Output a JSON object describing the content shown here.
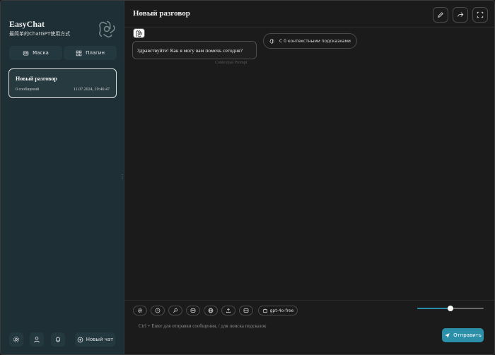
{
  "sidebar": {
    "brand_title": "EasyChat",
    "brand_subtitle": "最简单的ChatGPT使用方式",
    "logo_icon": "openai-logo-icon",
    "mask_button": {
      "label": "Маска",
      "icon": "mask-icon"
    },
    "plugin_button": {
      "label": "Плагин",
      "icon": "grid-plugin-icon"
    },
    "chats": [
      {
        "title": "Новый разговор",
        "count": "0 сообщений",
        "date": "11.07.2024, 19:46:47",
        "selected": true
      }
    ],
    "bottom_tools": [
      {
        "icon": "settings-icon"
      },
      {
        "icon": "user-icon"
      },
      {
        "icon": "bell-icon"
      }
    ],
    "new_chat_label": "Новый чат",
    "new_chat_icon": "plus-circle-icon"
  },
  "header": {
    "title": "Новый разговор",
    "actions": [
      "edit-icon",
      "share-icon",
      "fullscreen-icon"
    ]
  },
  "messages": [
    {
      "role": "bot",
      "avatar_icon": "openai-logo-icon",
      "text": "Здравствуйте! Как я могу вам помочь сегодня?",
      "meta": "Contextual Prompt"
    }
  ],
  "context_pill": {
    "label": "С 0 контекстными подсказками",
    "icon": "brain-icon"
  },
  "input_panel": {
    "tools": [
      "settings-icon",
      "clock-icon",
      "prompt-icon",
      "mask-icon",
      "globe-icon",
      "upload-icon",
      "clear-icon"
    ],
    "model_label": "gpt-4o-free",
    "model_icon": "robot-icon",
    "slider_level": 0.5,
    "placeholder": "Ctrl + Enter для отправки сообщения, / для поиска подсказок",
    "send_label": "Отправить",
    "send_icon": "send-icon"
  },
  "colors": {
    "sidebar_bg": "#1e2f35",
    "main_bg": "#1b1b1b",
    "accent": "#2c8fa8"
  }
}
